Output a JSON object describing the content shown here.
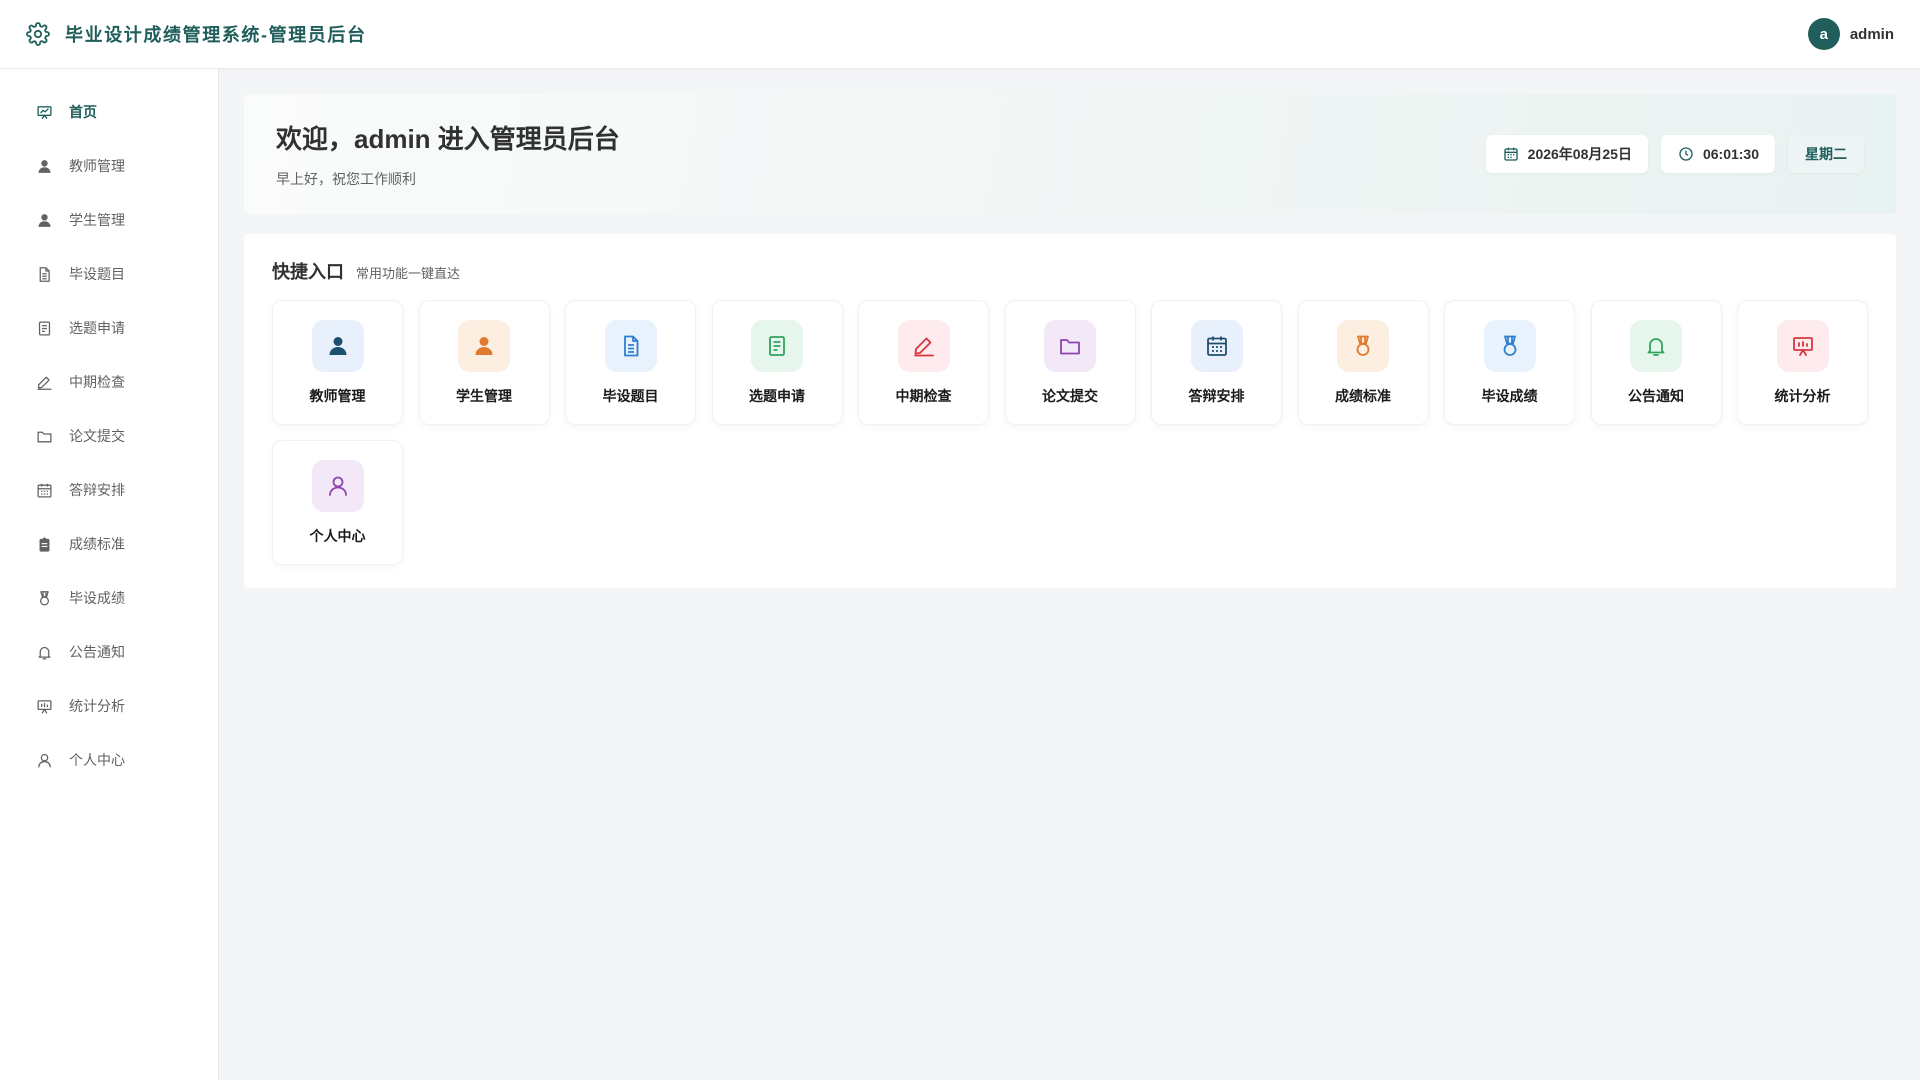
{
  "header": {
    "title": "毕业设计成绩管理系统-管理员后台",
    "avatar_letter": "a",
    "username": "admin"
  },
  "sidebar": {
    "items": [
      {
        "label": "首页",
        "icon": "dashboard-icon",
        "active": true
      },
      {
        "label": "教师管理",
        "icon": "user-solid-icon"
      },
      {
        "label": "学生管理",
        "icon": "user-solid-icon"
      },
      {
        "label": "毕设题目",
        "icon": "document-icon"
      },
      {
        "label": "选题申请",
        "icon": "document-list-icon"
      },
      {
        "label": "中期检查",
        "icon": "edit-icon"
      },
      {
        "label": "论文提交",
        "icon": "folder-icon"
      },
      {
        "label": "答辩安排",
        "icon": "calendar-icon"
      },
      {
        "label": "成绩标准",
        "icon": "clipboard-icon"
      },
      {
        "label": "毕设成绩",
        "icon": "medal-icon"
      },
      {
        "label": "公告通知",
        "icon": "bell-icon"
      },
      {
        "label": "统计分析",
        "icon": "chart-board-icon"
      },
      {
        "label": "个人中心",
        "icon": "user-outline-icon"
      }
    ]
  },
  "welcome": {
    "title": "欢迎，admin 进入管理员后台",
    "subtitle": "早上好，祝您工作顺利",
    "date": "2026年08月25日",
    "time": "06:01:30",
    "weekday": "星期二"
  },
  "quick": {
    "title": "快捷入口",
    "subtitle": "常用功能一键直达",
    "tiles": [
      {
        "label": "教师管理",
        "icon": "user-solid-icon",
        "bg": "#e8f1fb",
        "color": "#1f4f6e"
      },
      {
        "label": "学生管理",
        "icon": "user-solid-icon",
        "bg": "#fdeee2",
        "color": "#e07b2e"
      },
      {
        "label": "毕设题目",
        "icon": "document-icon",
        "bg": "#e8f2fc",
        "color": "#2f7fd0"
      },
      {
        "label": "选题申请",
        "icon": "document-list-icon",
        "bg": "#e6f6ec",
        "color": "#2fa35f"
      },
      {
        "label": "中期检查",
        "icon": "edit-icon",
        "bg": "#fdebee",
        "color": "#d9363e"
      },
      {
        "label": "论文提交",
        "icon": "folder-icon",
        "bg": "#f3e8f7",
        "color": "#8e44ad"
      },
      {
        "label": "答辩安排",
        "icon": "calendar-icon",
        "bg": "#e8f1fb",
        "color": "#1f4f6e"
      },
      {
        "label": "成绩标准",
        "icon": "medal-icon",
        "bg": "#fdeee2",
        "color": "#e07b2e"
      },
      {
        "label": "毕设成绩",
        "icon": "medal-icon",
        "bg": "#e8f2fc",
        "color": "#2f7fd0"
      },
      {
        "label": "公告通知",
        "icon": "bell-icon",
        "bg": "#e6f6ec",
        "color": "#2fa35f"
      },
      {
        "label": "统计分析",
        "icon": "chart-board-icon",
        "bg": "#fdebee",
        "color": "#d9363e"
      },
      {
        "label": "个人中心",
        "icon": "user-outline-icon",
        "bg": "#f3e8f7",
        "color": "#8e44ad"
      }
    ]
  },
  "colors": {
    "brand": "#1f5e5a",
    "text": "#303133",
    "muted": "#606266"
  }
}
